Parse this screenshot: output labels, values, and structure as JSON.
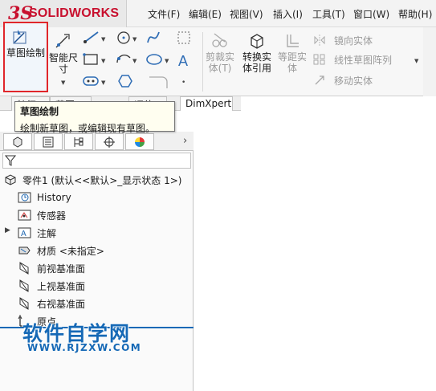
{
  "app": {
    "logo_ds": "3S",
    "logo_text": "SOLIDWORKS"
  },
  "menu": [
    {
      "label": "文件(F)"
    },
    {
      "label": "编辑(E)"
    },
    {
      "label": "视图(V)"
    },
    {
      "label": "插入(I)"
    },
    {
      "label": "工具(T)"
    },
    {
      "label": "窗口(W)"
    },
    {
      "label": "帮助(H)"
    }
  ],
  "ribbon": {
    "sketch": {
      "label": "草图绘制",
      "highlight_color": "#e0262b"
    },
    "smart_dimension": {
      "label": "智能尺寸"
    },
    "trim": {
      "label": "剪裁实体(T)"
    },
    "convert": {
      "label": "转换实体引用"
    },
    "offset": {
      "label": "等距实体"
    },
    "mirror": {
      "label": "镜向实体"
    },
    "linear_pattern": {
      "label": "线性草图阵列"
    },
    "move": {
      "label": "移动实体"
    }
  },
  "tabs": [
    {
      "label": "特征"
    },
    {
      "label": "草图"
    },
    {
      "label": "评估"
    },
    {
      "label": "DimXpert"
    }
  ],
  "tooltip": {
    "title": "草图绘制",
    "description": "绘制新草图，或编辑现有草图。"
  },
  "tree": {
    "root": "零件1 (默认<<默认>_显示状态 1>)",
    "items": [
      {
        "label": "History",
        "icon": "history-icon"
      },
      {
        "label": "传感器",
        "icon": "sensor-icon"
      },
      {
        "label": "注解",
        "icon": "annotation-icon"
      },
      {
        "label": "材质 <未指定>",
        "icon": "material-icon"
      },
      {
        "label": "前视基准面",
        "icon": "plane-icon"
      },
      {
        "label": "上视基准面",
        "icon": "plane-icon"
      },
      {
        "label": "右视基准面",
        "icon": "plane-icon"
      },
      {
        "label": "原点",
        "icon": "origin-icon"
      }
    ]
  },
  "watermark": {
    "main": "软件自学网",
    "url": "WWW.RJZXW.COM",
    "color": "#1669b6"
  }
}
